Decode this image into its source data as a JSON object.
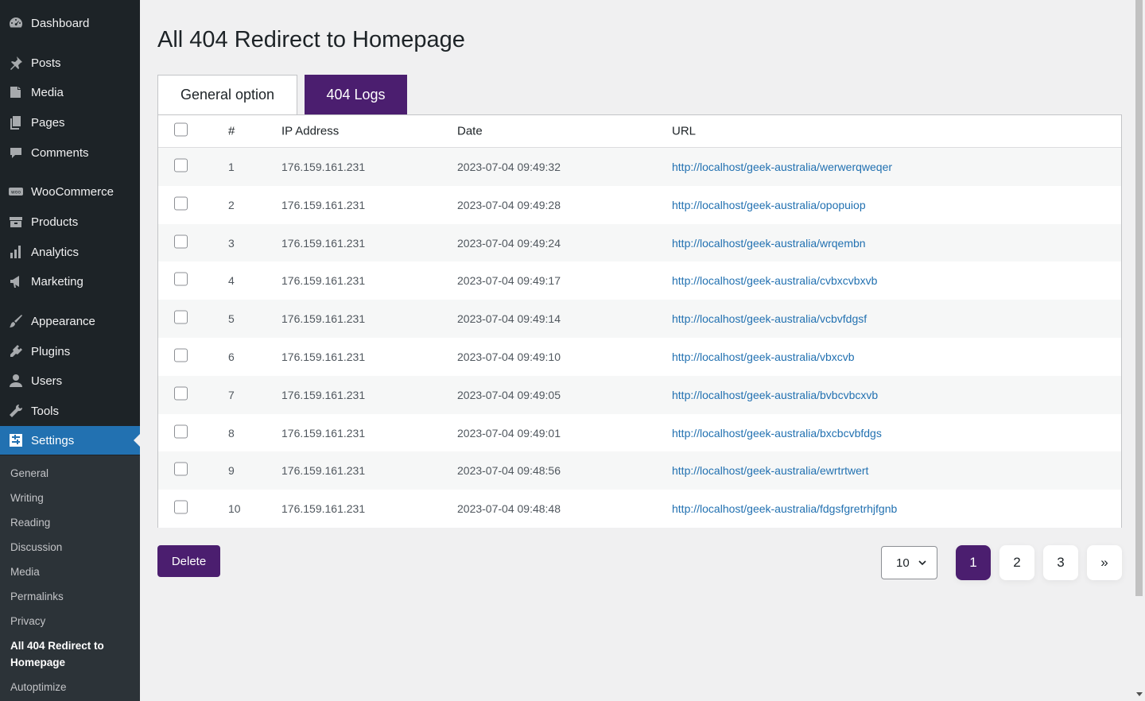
{
  "sidebar": {
    "items": [
      {
        "label": "Dashboard",
        "icon": "dashboard-icon"
      },
      {
        "label": "Posts",
        "icon": "pin-icon"
      },
      {
        "label": "Media",
        "icon": "media-icon"
      },
      {
        "label": "Pages",
        "icon": "pages-icon"
      },
      {
        "label": "Comments",
        "icon": "comment-icon"
      },
      {
        "label": "WooCommerce",
        "icon": "woo-icon"
      },
      {
        "label": "Products",
        "icon": "archive-icon"
      },
      {
        "label": "Analytics",
        "icon": "chart-bar-icon"
      },
      {
        "label": "Marketing",
        "icon": "megaphone-icon"
      },
      {
        "label": "Appearance",
        "icon": "brush-icon"
      },
      {
        "label": "Plugins",
        "icon": "plugin-icon"
      },
      {
        "label": "Users",
        "icon": "user-icon"
      },
      {
        "label": "Tools",
        "icon": "wrench-icon"
      },
      {
        "label": "Settings",
        "icon": "settings-icon"
      }
    ],
    "submenu": [
      {
        "label": "General"
      },
      {
        "label": "Writing"
      },
      {
        "label": "Reading"
      },
      {
        "label": "Discussion"
      },
      {
        "label": "Media"
      },
      {
        "label": "Permalinks"
      },
      {
        "label": "Privacy"
      },
      {
        "label": "All 404 Redirect to Homepage"
      },
      {
        "label": "Autoptimize"
      }
    ]
  },
  "page": {
    "title": "All 404 Redirect to Homepage",
    "tabs": [
      {
        "label": "General option"
      },
      {
        "label": "404 Logs"
      }
    ]
  },
  "table": {
    "headers": {
      "num": "#",
      "ip": "IP Address",
      "date": "Date",
      "url": "URL"
    },
    "rows": [
      {
        "num": "1",
        "ip": "176.159.161.231",
        "date": "2023-07-04 09:49:32",
        "url": "http://localhost/geek-australia/werwerqweqer"
      },
      {
        "num": "2",
        "ip": "176.159.161.231",
        "date": "2023-07-04 09:49:28",
        "url": "http://localhost/geek-australia/opopuiop"
      },
      {
        "num": "3",
        "ip": "176.159.161.231",
        "date": "2023-07-04 09:49:24",
        "url": "http://localhost/geek-australia/wrqembn"
      },
      {
        "num": "4",
        "ip": "176.159.161.231",
        "date": "2023-07-04 09:49:17",
        "url": "http://localhost/geek-australia/cvbxcvbxvb"
      },
      {
        "num": "5",
        "ip": "176.159.161.231",
        "date": "2023-07-04 09:49:14",
        "url": "http://localhost/geek-australia/vcbvfdgsf"
      },
      {
        "num": "6",
        "ip": "176.159.161.231",
        "date": "2023-07-04 09:49:10",
        "url": "http://localhost/geek-australia/vbxcvb"
      },
      {
        "num": "7",
        "ip": "176.159.161.231",
        "date": "2023-07-04 09:49:05",
        "url": "http://localhost/geek-australia/bvbcvbcxvb"
      },
      {
        "num": "8",
        "ip": "176.159.161.231",
        "date": "2023-07-04 09:49:01",
        "url": "http://localhost/geek-australia/bxcbcvbfdgs"
      },
      {
        "num": "9",
        "ip": "176.159.161.231",
        "date": "2023-07-04 09:48:56",
        "url": "http://localhost/geek-australia/ewrtrtwert"
      },
      {
        "num": "10",
        "ip": "176.159.161.231",
        "date": "2023-07-04 09:48:48",
        "url": "http://localhost/geek-australia/fdgsfgretrhjfgnb"
      }
    ]
  },
  "actions": {
    "delete_label": "Delete"
  },
  "pagination": {
    "per_page": "10",
    "pages": [
      "1",
      "2",
      "3",
      "»"
    ]
  },
  "colors": {
    "accent": "#4b1e6f",
    "wp_blue": "#2271b1",
    "sidebar": "#1d2327"
  }
}
